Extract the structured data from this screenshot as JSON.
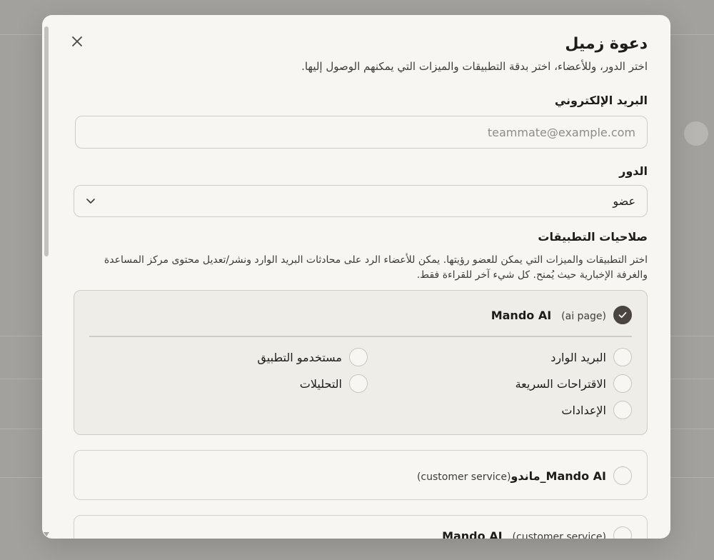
{
  "dialog": {
    "title": "دعوة زميل",
    "subtitle": "اختر الدور، وللأعضاء، اختر بدقة التطبيقات والميزات التي يمكنهم الوصول إليها."
  },
  "email": {
    "label": "البريد الإلكتروني",
    "placeholder": "teammate@example.com",
    "value": ""
  },
  "role": {
    "label": "الدور",
    "selected": "عضو"
  },
  "permissions": {
    "heading": "صلاحيات التطبيقات",
    "description": "اختر التطبيقات والميزات التي يمكن للعضو رؤيتها. يمكن للأعضاء الرد على محادثات البريد الوارد ونشر/تعديل محتوى مركز المساعدة والغرفة الإخبارية حيث يُمنح. كل شيء آخر للقراءة فقط.",
    "apps": [
      {
        "name": "Mando AI",
        "type": "(ai page)",
        "checked": true,
        "features": [
          {
            "label": "البريد الوارد",
            "checked": false
          },
          {
            "label": "مستخدمو التطبيق",
            "checked": false
          },
          {
            "label": "الاقتراحات السريعة",
            "checked": false
          },
          {
            "label": "التحليلات",
            "checked": false
          },
          {
            "label": "الإعدادات",
            "checked": false
          }
        ]
      },
      {
        "name": "Mando AI_ماندو",
        "type": "(customer service)",
        "checked": false
      },
      {
        "name": "Mando AI",
        "type": "(customer service)",
        "checked": false
      }
    ]
  },
  "colors": {
    "accent": "#4a4540",
    "modal_bg": "#f8f6f2",
    "backdrop": "#a3a19d"
  },
  "icons": {
    "close": "close-icon",
    "chevron": "chevron-down-icon",
    "check": "check-icon"
  }
}
